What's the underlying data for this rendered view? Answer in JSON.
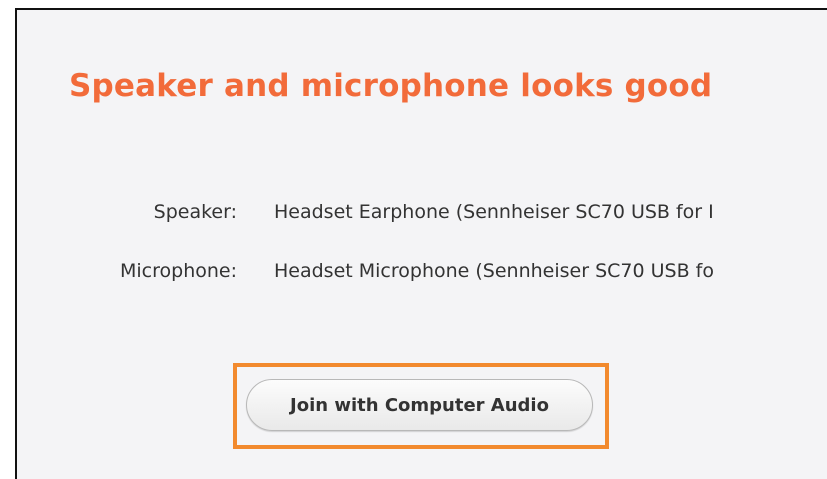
{
  "header": {
    "title": "Speaker and microphone looks good"
  },
  "devices": {
    "speaker_label": "Speaker:",
    "speaker_value": "Headset Earphone (Sennheiser SC70 USB for I",
    "microphone_label": "Microphone:",
    "microphone_value": "Headset Microphone (Sennheiser SC70 USB fo"
  },
  "actions": {
    "join_label": "Join with Computer Audio"
  },
  "colors": {
    "title_accent": "#f26b3a",
    "highlight_outline": "#f28a2e",
    "background": "#f4f4f6"
  }
}
